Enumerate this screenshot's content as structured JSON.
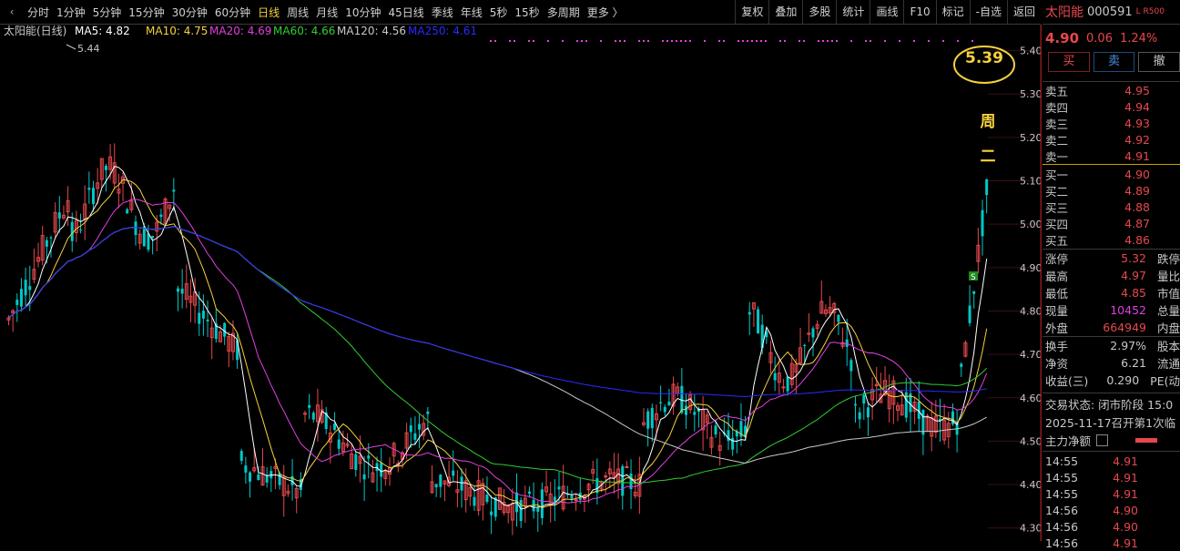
{
  "toolbar": {
    "periods": [
      "分时",
      "1分钟",
      "5分钟",
      "15分钟",
      "30分钟",
      "60分钟",
      "日线",
      "周线",
      "月线",
      "10分钟",
      "45日线",
      "季线",
      "年线",
      "5秒",
      "15秒",
      "多周期",
      "更多 〉"
    ],
    "active_index": 6,
    "tools": [
      "复权",
      "叠加",
      "多股",
      "统计",
      "画线",
      "F10",
      "标记",
      "-自选",
      "返回"
    ]
  },
  "chart": {
    "legend": {
      "name": "太阳能(日线)",
      "ma5": "MA5: 4.82",
      "ma10": "MA10: 4.75",
      "ma20": "MA20: 4.69",
      "ma60": "MA60: 4.66",
      "ma120": "MA120: 4.56",
      "ma250": "MA250: 4.61"
    },
    "colors": {
      "ma5": "#ffffff",
      "ma10": "#f5d13c",
      "ma20": "#e040e0",
      "ma60": "#32cd32",
      "ma120": "#c8c8c8",
      "ma250": "#2a2aff",
      "up": "#e5484d",
      "down": "#00c8c8"
    },
    "high_label": "5.44",
    "annot_price": "5.39",
    "annot_text": [
      "周",
      "二"
    ],
    "s_badge": "S",
    "axis_ticks": [
      "5.40",
      "5.30",
      "5.20",
      "5.10",
      "5.00",
      "4.90",
      "4.80",
      "4.70",
      "4.60",
      "4.50",
      "4.40",
      "4.30"
    ]
  },
  "panel": {
    "name": "太阳能",
    "code": "000591",
    "badge": "L R500",
    "price": "4.90",
    "change": "0.06",
    "pct": "1.24%",
    "buy_label": "买",
    "sell_label": "卖",
    "cancel_label": "撤",
    "asks": [
      [
        "卖五",
        "4.95"
      ],
      [
        "卖四",
        "4.94"
      ],
      [
        "卖三",
        "4.93"
      ],
      [
        "卖二",
        "4.92"
      ],
      [
        "卖一",
        "4.91"
      ]
    ],
    "bids": [
      [
        "买一",
        "4.90"
      ],
      [
        "买二",
        "4.89"
      ],
      [
        "买三",
        "4.88"
      ],
      [
        "买四",
        "4.87"
      ],
      [
        "买五",
        "4.86"
      ]
    ],
    "stats": [
      [
        "涨停",
        "5.32",
        "跌停"
      ],
      [
        "最高",
        "4.97",
        "量比"
      ],
      [
        "最低",
        "4.85",
        "市值"
      ],
      [
        "现量",
        "10452",
        "总量"
      ],
      [
        "外盘",
        "664949",
        "内盘"
      ],
      [
        "换手",
        "2.97%",
        "股本"
      ],
      [
        "净资",
        "6.21",
        "流通"
      ],
      [
        "收益(三)",
        "0.290",
        "PE(动"
      ]
    ],
    "trade_status": "交易状态: 闭市阶段 15:0",
    "notice": "2025-11-17召开第1次临",
    "net_label": "主力净额",
    "ticks": [
      [
        "14:55",
        "4.91"
      ],
      [
        "14:55",
        "4.91"
      ],
      [
        "14:55",
        "4.91"
      ],
      [
        "14:56",
        "4.90"
      ],
      [
        "14:56",
        "4.90"
      ],
      [
        "14:56",
        "4.91"
      ]
    ]
  }
}
